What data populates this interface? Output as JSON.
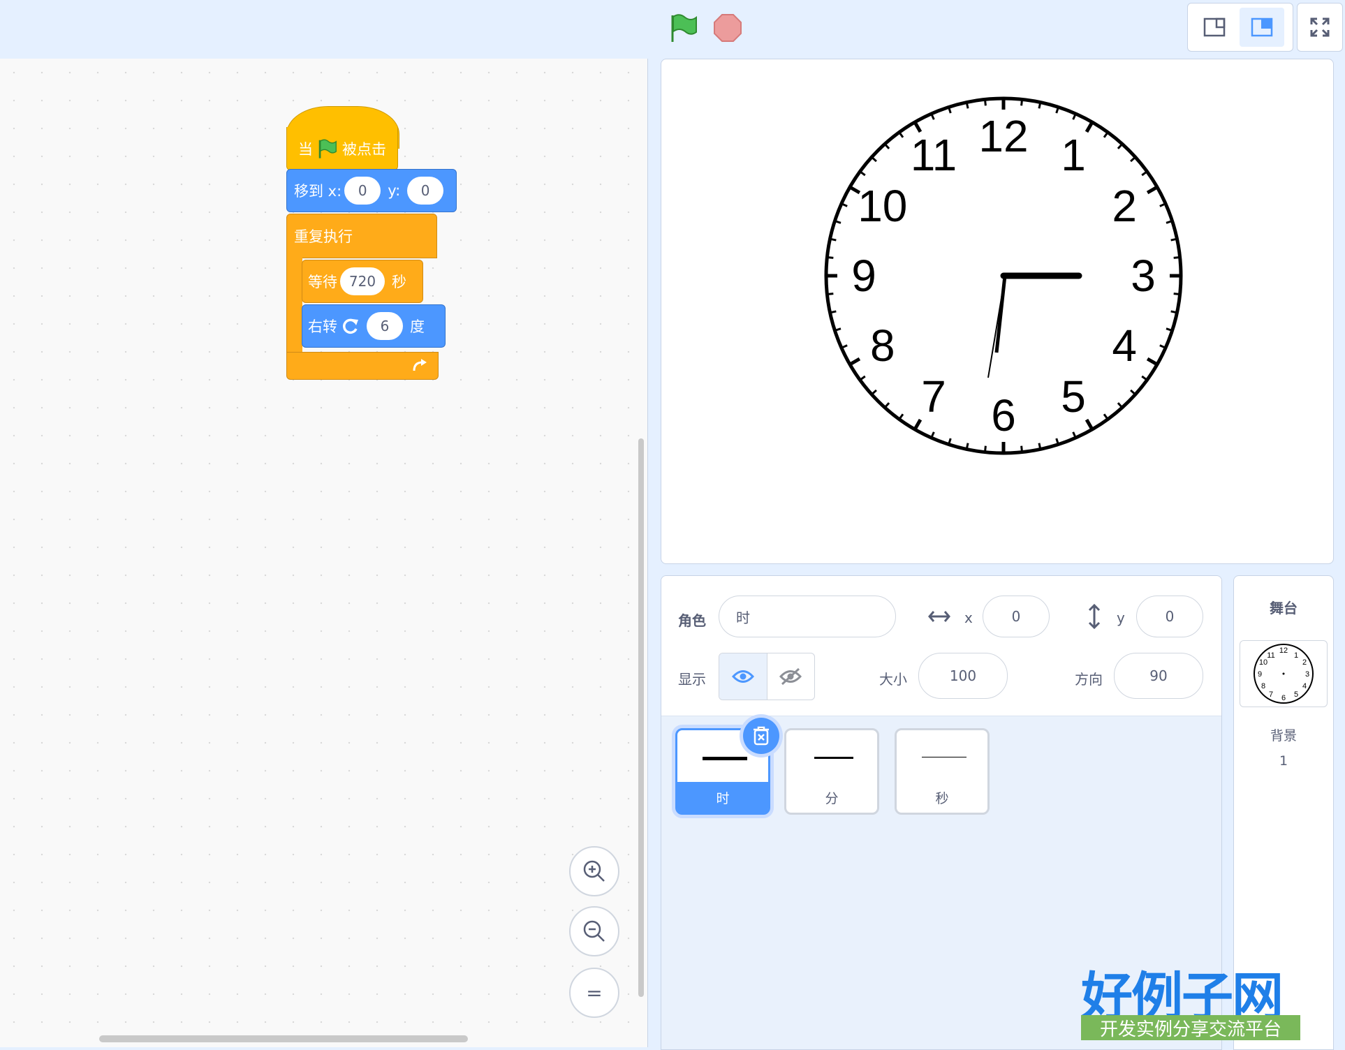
{
  "code": {
    "hat": {
      "when": "当",
      "clicked": "被点击"
    },
    "move": {
      "label": "移到 x:",
      "x": "0",
      "y_label": "y:",
      "y": "0"
    },
    "forever": {
      "label": "重复执行"
    },
    "wait": {
      "label": "等待",
      "value": "720",
      "unit": "秒"
    },
    "turn": {
      "label": "右转",
      "value": "6",
      "unit": "度"
    },
    "zoom_reset": "="
  },
  "clock": {
    "numbers": [
      "12",
      "1",
      "2",
      "3",
      "4",
      "5",
      "6",
      "7",
      "8",
      "9",
      "10",
      "11"
    ]
  },
  "sprite_info": {
    "sprite_label": "角色",
    "sprite_name": "时",
    "x_label": "x",
    "x": "0",
    "y_label": "y",
    "y": "0",
    "show_label": "显示",
    "size_label": "大小",
    "size": "100",
    "direction_label": "方向",
    "direction": "90"
  },
  "sprites": [
    {
      "name": "时",
      "selected": true
    },
    {
      "name": "分",
      "selected": false
    },
    {
      "name": "秒",
      "selected": false
    }
  ],
  "stage_panel": {
    "title": "舞台",
    "backdrop_label": "背景",
    "backdrop_count": "1"
  },
  "watermark": {
    "brand": "好例子网",
    "tagline": "开发实例分享交流平台",
    "url_pattern": "www.haolizi.com"
  },
  "colors": {
    "motion": "#4c97ff",
    "control": "#ffab19",
    "events": "#ffbf00",
    "accent": "#4c97ff"
  }
}
